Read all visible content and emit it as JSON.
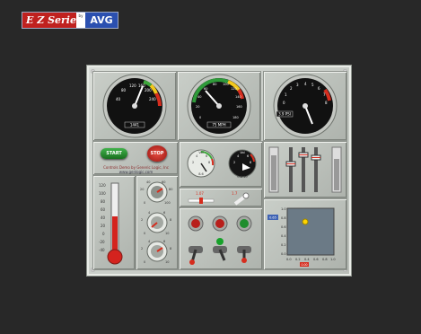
{
  "logo": {
    "product": "E Z Series",
    "by": "by",
    "brand": "AVG"
  },
  "gauges": [
    {
      "name": "gauge-1",
      "label": "1441",
      "ticks": [
        "40",
        "80",
        "120",
        "160",
        "200",
        "240"
      ]
    },
    {
      "name": "gauge-2",
      "label": "75 MPH",
      "ticks": [
        "0",
        "20",
        "40",
        "60",
        "80",
        "100",
        "120",
        "140",
        "160",
        "180"
      ]
    },
    {
      "name": "gauge-3",
      "label": "3.9 PSI",
      "ticks": [
        "0",
        "1",
        "2",
        "3",
        "4",
        "5",
        "6",
        "7",
        "8",
        "9",
        "10"
      ]
    }
  ],
  "buttons": {
    "start": "START",
    "stop": "STOP"
  },
  "credits": {
    "line1": "Controls Demo by Generic Logic, Inc",
    "line2": "www.genlogic.com"
  },
  "thermometer": {
    "ticks": [
      "120",
      "100",
      "80",
      "60",
      "40",
      "20",
      "0",
      "-20",
      "-40"
    ]
  },
  "small_dials": {
    "dial1": {
      "title": "Vol",
      "ticks": [
        "2",
        "4",
        "6",
        "8"
      ],
      "readout": "8.6"
    },
    "dial2": {
      "title": "Vol",
      "ticks": [
        "2",
        "4",
        "6",
        "8"
      ],
      "readout": "0.8 10"
    }
  },
  "knob_ticks": {
    "knob1": [
      "40",
      "20",
      "60",
      "80",
      "0",
      "100"
    ],
    "knob2": [
      "4",
      "6",
      "2",
      "8",
      "0",
      "10"
    ],
    "knob3": [
      "4",
      "6",
      "2",
      "8",
      "0",
      "10"
    ]
  },
  "sliders": {
    "label1": "1.07",
    "label2": "1.7"
  },
  "plot": {
    "y_ticks": [
      "1.0",
      "0.8",
      "0.6",
      "0.4",
      "0.2",
      "0.0"
    ],
    "x_ticks": [
      "0.0",
      "0.2",
      "0.4",
      "0.6",
      "0.8",
      "1.0"
    ],
    "value_box": "0.65",
    "badge": "0.00"
  }
}
